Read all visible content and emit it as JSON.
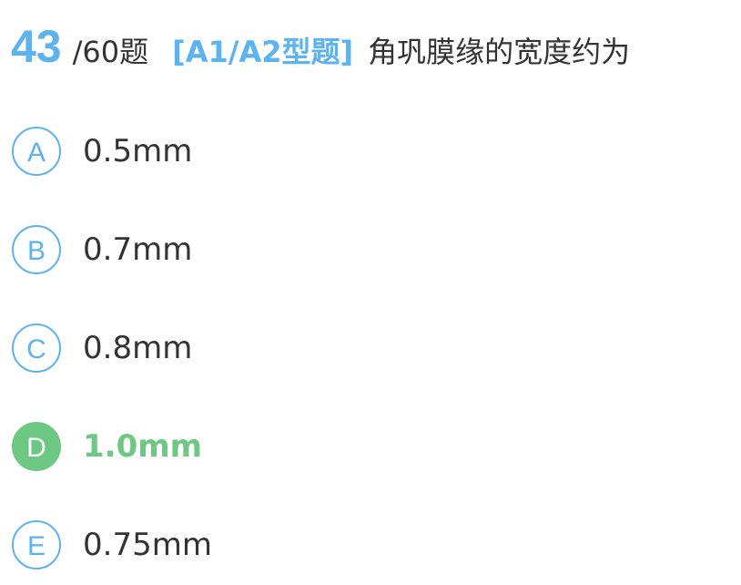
{
  "question": {
    "number": "43",
    "total": "/60题",
    "type": "[A1/A2型题]",
    "stem": "角巩膜缘的宽度约为"
  },
  "options": [
    {
      "letter": "A",
      "text": "0.5mm",
      "state": "normal"
    },
    {
      "letter": "B",
      "text": "0.7mm",
      "state": "normal"
    },
    {
      "letter": "C",
      "text": "0.8mm",
      "state": "normal"
    },
    {
      "letter": "D",
      "text": "1.0mm",
      "state": "correct"
    },
    {
      "letter": "E",
      "text": "0.75mm",
      "state": "normal"
    }
  ],
  "colors": {
    "accent": "#5bb3f0",
    "correct": "#6cc883",
    "text": "#333333"
  }
}
